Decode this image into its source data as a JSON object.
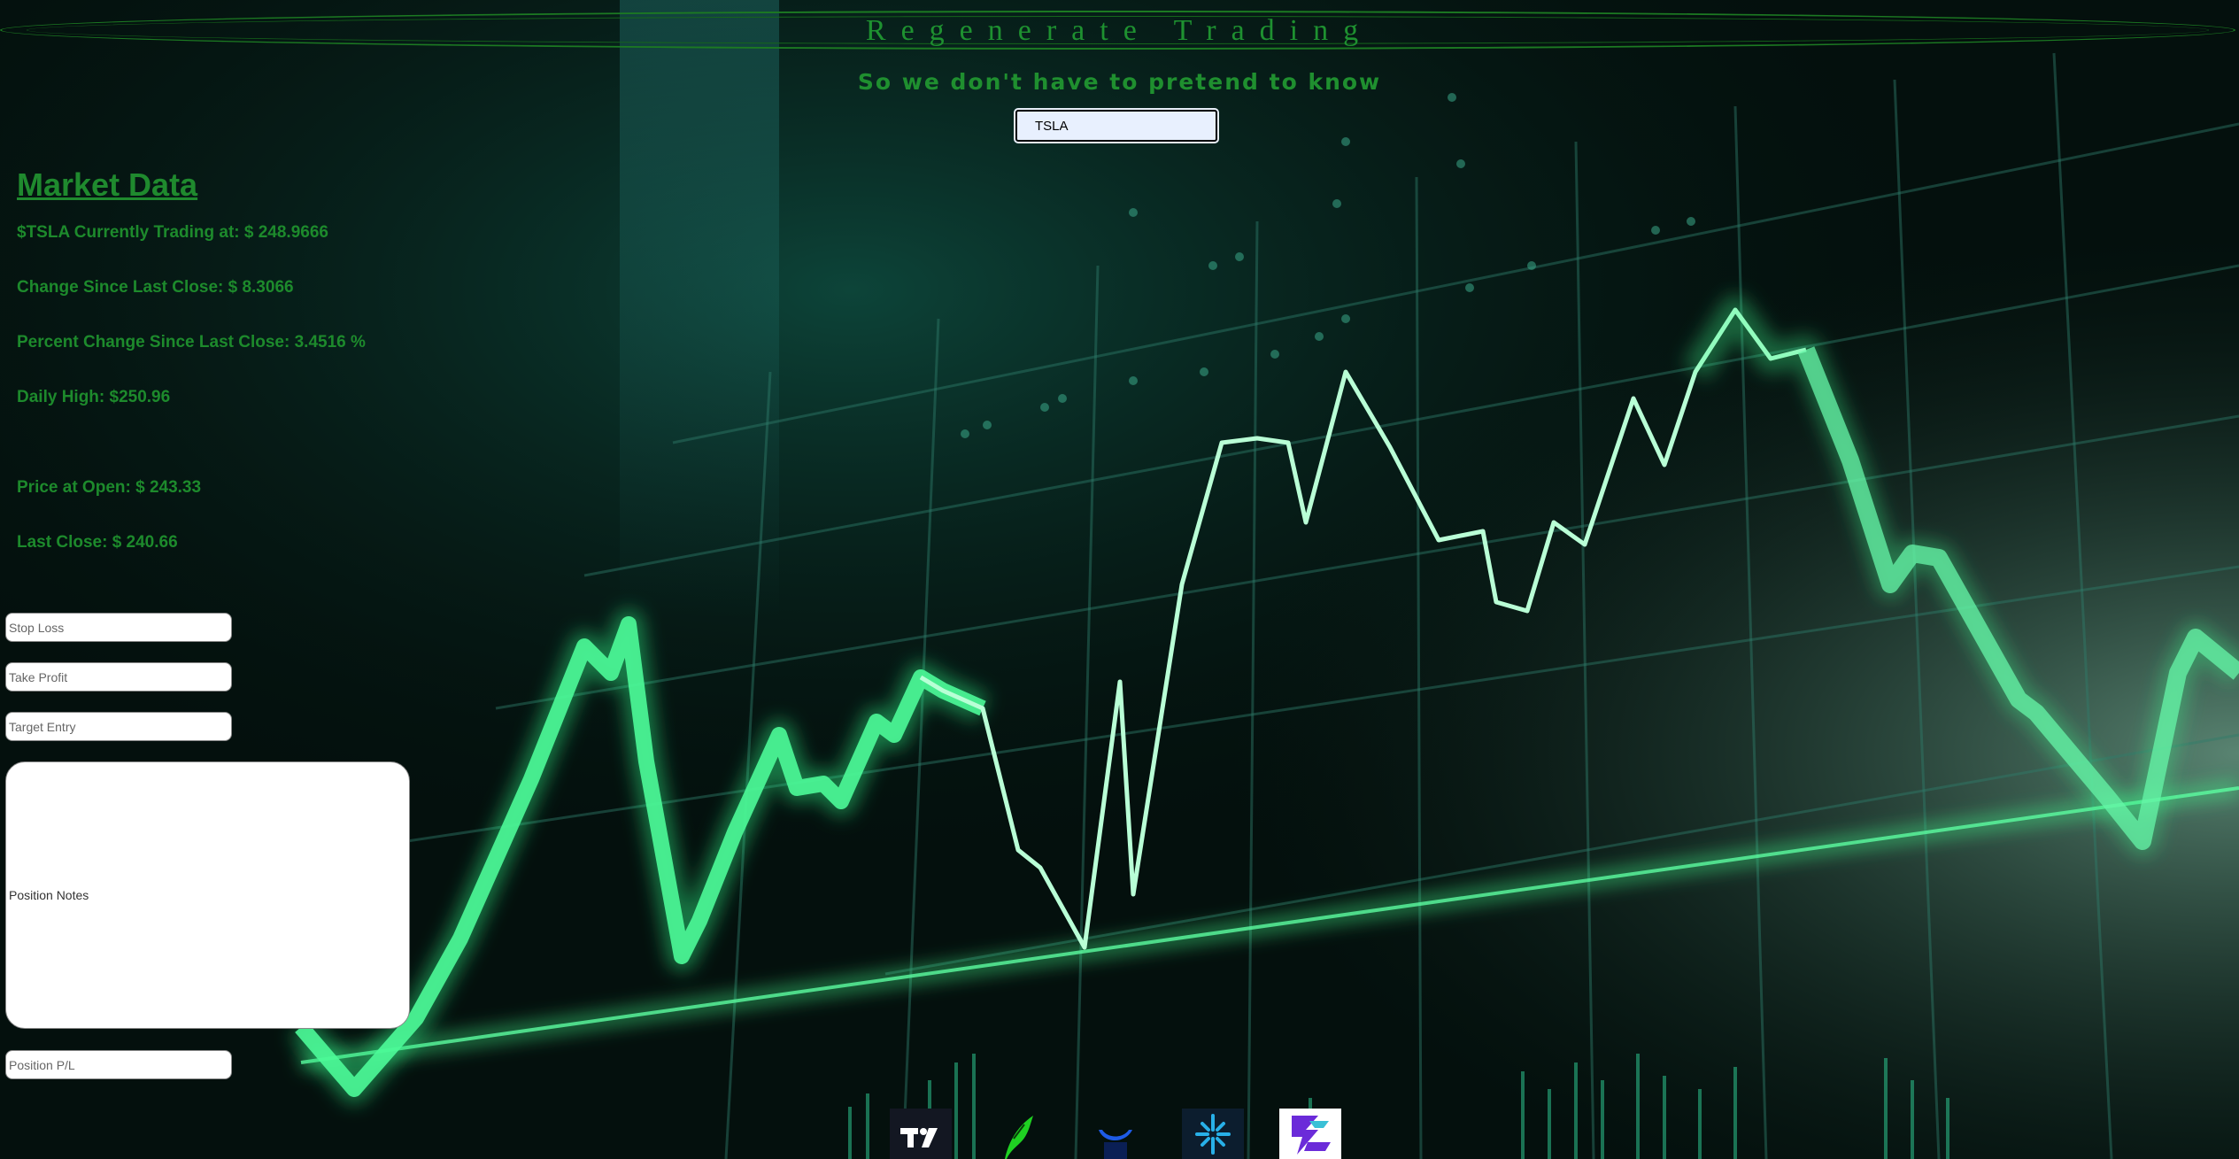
{
  "header": {
    "title": "Regenerate Trading",
    "tagline": "So we don't have to pretend to know"
  },
  "search": {
    "value": "TSLA"
  },
  "market": {
    "heading": "Market Data",
    "current_price": "$TSLA Currently Trading at: $ 248.9666",
    "change": "Change Since Last Close: $ 8.3066",
    "percent_change": "Percent Change Since Last Close: 3.4516 %",
    "daily_high": "Daily High: $250.96",
    "open_price": "Price at Open: $ 243.33",
    "last_close": "Last Close: $ 240.66"
  },
  "form": {
    "stop_loss_placeholder": "Stop Loss",
    "take_profit_placeholder": "Take Profit",
    "target_entry_placeholder": "Target Entry",
    "notes_placeholder": "Position Notes",
    "pl_placeholder": "Position P/L"
  },
  "brokers": [
    {
      "icon": "tradingview-icon"
    },
    {
      "icon": "robinhood-icon"
    },
    {
      "icon": "webull-icon"
    },
    {
      "icon": "public-icon"
    },
    {
      "icon": "etrade-icon"
    }
  ],
  "colors": {
    "accent": "#1f8a2e",
    "chart_line": "#5dfba0"
  }
}
